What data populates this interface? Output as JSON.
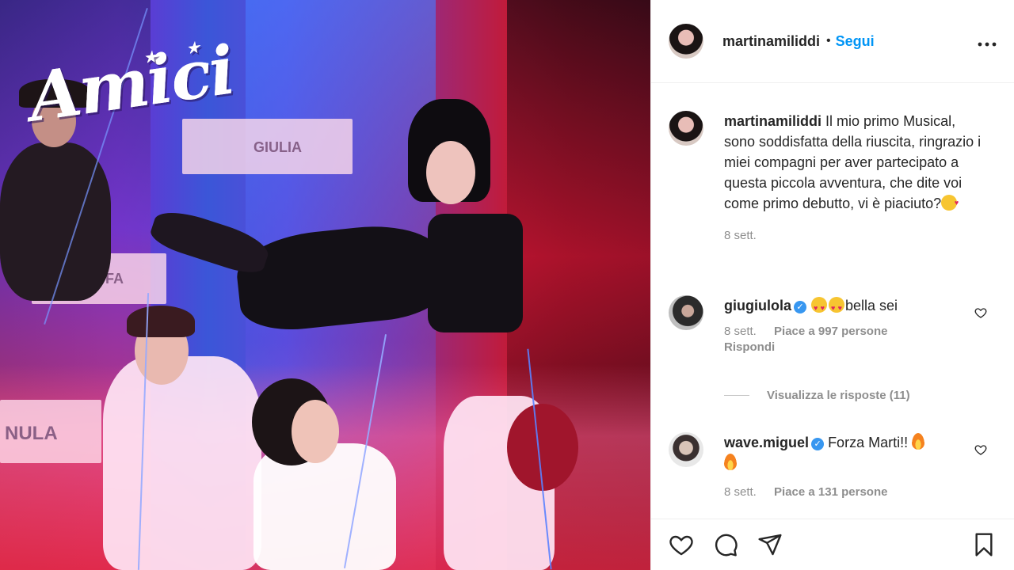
{
  "post": {
    "image_logo_text": "Amici",
    "desk_labels": [
      "GIULIA",
      "RAFFA",
      "NULA"
    ]
  },
  "header": {
    "username": "martinamiliddi",
    "separator": "•",
    "follow_label": "Segui",
    "more_label": "•••"
  },
  "caption": {
    "username": "martinamiliddi",
    "text": "Il mio primo Musical, sono soddisfatta della riuscita, ringrazio i miei compagni per aver partecipato a questa piccola avventura, che dite voi come primo debutto, vi è piaciuto?",
    "emoji": "smiling-face-with-hearts",
    "date": "8 sett."
  },
  "comments": [
    {
      "username": "giugiulola",
      "verified": true,
      "text": "bella sei",
      "emoji_prefix": [
        "heart-eyes",
        "heart-eyes"
      ],
      "date": "8 sett.",
      "likes": "Piace a 997 persone",
      "reply": "Rispondi",
      "view_replies": "Visualizza le risposte (11)"
    },
    {
      "username": "wave.miguel",
      "verified": true,
      "text": "Forza Marti!!",
      "emoji_suffix": [
        "fire",
        "fire"
      ],
      "date": "8 sett.",
      "likes": "Piace a 131 persone"
    }
  ],
  "actions": {
    "icons": [
      "heart-icon",
      "comment-icon",
      "share-icon",
      "bookmark-icon"
    ]
  },
  "colors": {
    "link_blue": "#0095f6",
    "secondary_text": "#8e8e8e",
    "verified_blue": "#3897f0"
  }
}
